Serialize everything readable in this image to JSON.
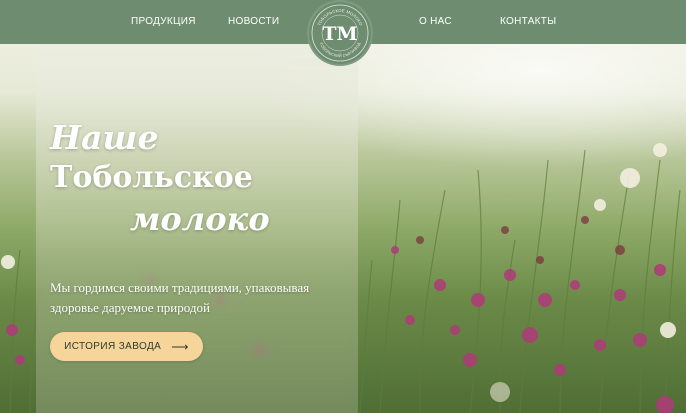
{
  "nav": {
    "items": [
      {
        "label": "ПРОДУКЦИЯ"
      },
      {
        "label": "НОВОСТИ"
      },
      {
        "label": "О НАС"
      },
      {
        "label": "КОНТАКТЫ"
      }
    ]
  },
  "logo": {
    "letters": "ТМ",
    "ring_top": "ТОБОЛЬСКОЕ МОЛОКО",
    "ring_bottom": "ТОБОЛЬСКИЙ СЫРЗАВОД"
  },
  "hero": {
    "headline_line1": "Наше",
    "headline_line2": "Тобольское",
    "headline_line3": "молоко",
    "subtitle": "Мы гордимся своими традициями, упаковывая здоровье даруемое природой",
    "cta_label": "ИСТОРИЯ ЗАВОДА",
    "cta_arrow": "arrow-right-icon"
  },
  "colors": {
    "navbar": "#6e8c6f",
    "cta_background": "#f5d59a",
    "headline_text": "#ffffff"
  }
}
